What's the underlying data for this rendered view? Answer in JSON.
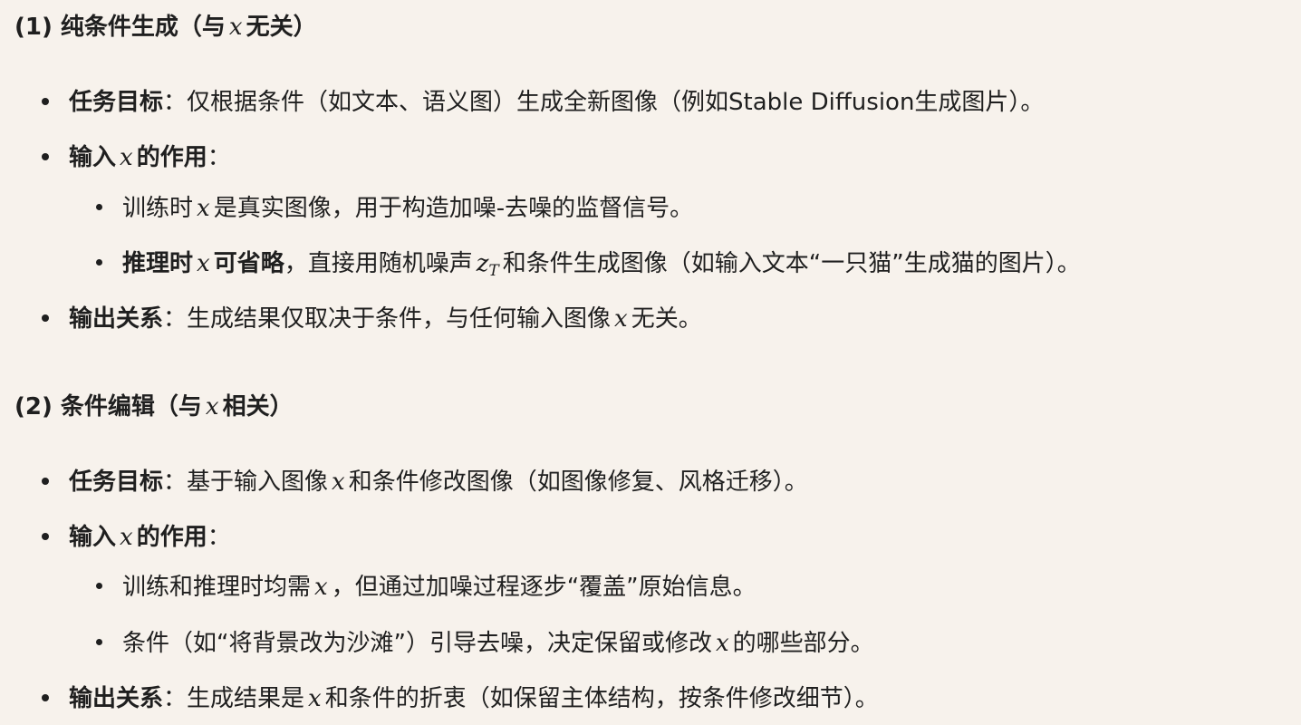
{
  "var": "x",
  "z": "z",
  "zsub": "T",
  "s1": {
    "heading_pre": "(1) 纯条件生成（与",
    "heading_post": "无关）",
    "goal_label": "任务目标",
    "goal_text": "：仅根据条件（如文本、语义图）生成全新图像（例如Stable Diffusion生成图片）。",
    "input_label_pre": "输入",
    "input_label_post": "的作用",
    "colon": "：",
    "sub1_pre": "训练时",
    "sub1_post": "是真实图像，用于构造加噪-去噪的监督信号。",
    "sub2_label_pre": "推理时",
    "sub2_label_post": "可省略",
    "sub2_mid": "，直接用随机噪声",
    "sub2_post": "和条件生成图像（如输入文本“一只猫”生成猫的图片）。",
    "out_label": "输出关系",
    "out_pre": "：生成结果仅取决于条件，与任何输入图像",
    "out_post": "无关。"
  },
  "s2": {
    "heading_pre": "(2) 条件编辑（与",
    "heading_post": "相关）",
    "goal_label": "任务目标",
    "goal_pre": "：基于输入图像",
    "goal_post": "和条件修改图像（如图像修复、风格迁移）。",
    "input_label_pre": "输入",
    "input_label_post": "的作用",
    "colon": "：",
    "sub1_pre": "训练和推理时均需",
    "sub1_post": "，但通过加噪过程逐步“覆盖”原始信息。",
    "sub2_pre": "条件（如“将背景改为沙滩”）引导去噪，决定保留或修改",
    "sub2_post": "的哪些部分。",
    "out_label": "输出关系",
    "out_pre": "：生成结果是",
    "out_post": "和条件的折衷（如保留主体结构，按条件修改细节）。"
  }
}
